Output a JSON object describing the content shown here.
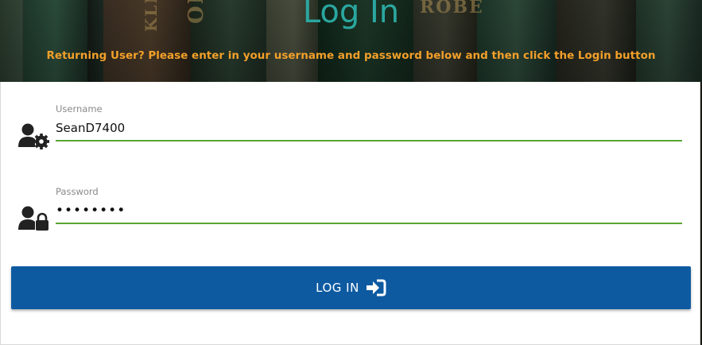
{
  "header": {
    "title": "Log In",
    "subtitle": "Returning User? Please enter in your username and password below and then click the Login button"
  },
  "background_spines": [
    "ORDS",
    "KLN",
    "ROBE"
  ],
  "form": {
    "username": {
      "label": "Username",
      "value": "SeanD7400",
      "icon": "user-gear-icon"
    },
    "password": {
      "label": "Password",
      "value": "••••••••",
      "icon": "user-lock-icon"
    },
    "submit": {
      "label": "LOG IN",
      "icon": "sign-in-icon"
    }
  },
  "colors": {
    "title": "#2aa7a0",
    "subtitle": "#f2a02a",
    "input_underline": "#5aa534",
    "button": "#0d5aa1"
  }
}
